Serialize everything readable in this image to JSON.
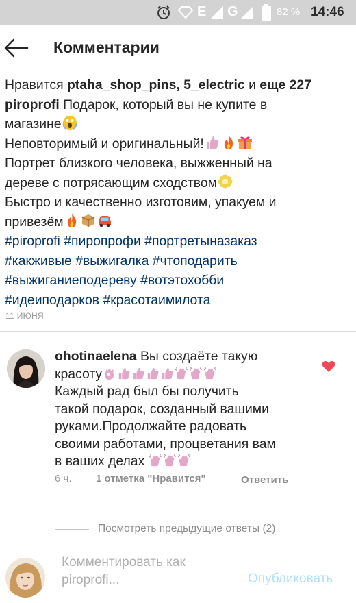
{
  "status_bar": {
    "alarm_icon": "alarm-clock-icon",
    "signal_icon": "signal-icon",
    "network_e": "E",
    "network_g": "G",
    "battery_percent": "82 %",
    "battery_icon": "battery-icon",
    "time": "14:46"
  },
  "header": {
    "back_icon": "arrow-left-icon",
    "title": "Комментарии"
  },
  "post": {
    "likes_prefix": "Нравится ",
    "liked_by": "ptaha_shop_pins, 5_electric",
    "likes_and": " и ",
    "likes_more": "еще 227",
    "author": "piroprofi",
    "caption_lines": [
      " Подарок, который вы не купите в",
      "магазине",
      "Неповторимый и оригинальный!",
      "Портрет близкого человека, выжженный на",
      "дереве с потрясающим сходством",
      "Быстро и качественно изготовим, упакуем и",
      "привезём"
    ],
    "hashtags": [
      "#piroprofi",
      "#пиропрофи",
      "#портретыназаказ",
      "#какживые",
      "#выжигалка",
      "#чтоподарить",
      "#выжиганиеподереву",
      "#вотэтохобби",
      "#идеиподарков",
      "#красотаимилота"
    ],
    "date": "11 ИЮНЯ"
  },
  "comment": {
    "username": "ohotinaelena",
    "text_lines": [
      " Вы создаёте такую",
      "красоту",
      "Каждый рад был бы получить",
      "такой подарок, созданный вашими",
      "руками.Продолжайте радовать",
      "своими работами, процветания вам",
      "в ваших делах"
    ],
    "time_ago": "6 ч.",
    "likes": "1 отметка \"Нравится\"",
    "reply": "Ответить",
    "liked": true,
    "heart_color": "#ed4956"
  },
  "replies": {
    "view_label": "Посмотреть предыдущие ответы (2)"
  },
  "composer": {
    "placeholder": "Комментировать как piroprofi...",
    "publish_label": "Опубликовать",
    "publish_color": "#b2dffc"
  }
}
